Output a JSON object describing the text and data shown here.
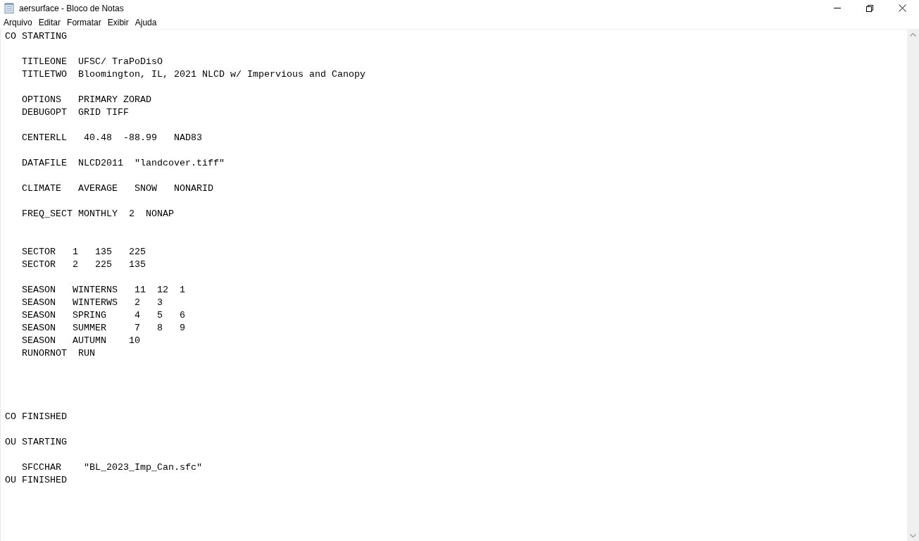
{
  "window": {
    "title": "aersurface - Bloco de Notas"
  },
  "menu": [
    "Arquivo",
    "Editar",
    "Formatar",
    "Exibir",
    "Ajuda"
  ],
  "lines": [
    {
      "kind": "text",
      "text": "CO STARTING"
    },
    {
      "kind": "blank"
    },
    {
      "kind": "text",
      "text": "   TITLEONE  UFSC/ TraPoDisO"
    },
    {
      "kind": "text",
      "text": "   TITLETWO  Bloomington, IL, 2021 NLCD w/ Impervious and Canopy"
    },
    {
      "kind": "blank"
    },
    {
      "kind": "text",
      "text": "   OPTIONS   PRIMARY ZORAD"
    },
    {
      "kind": "text",
      "text": "   DEBUGOPT  GRID TIFF"
    },
    {
      "kind": "blank"
    },
    {
      "kind": "text",
      "text": "   CENTERLL   40.48  -88.99   NAD83"
    },
    {
      "kind": "blank"
    },
    {
      "kind": "text",
      "text": "   DATAFILE  NLCD2011  \"landcover.tiff\""
    },
    {
      "kind": "blank"
    },
    {
      "kind": "text",
      "text": "   CLIMATE   AVERAGE   SNOW   NONARID"
    },
    {
      "kind": "blank"
    },
    {
      "kind": "text",
      "text": "   FREQ_SECT MONTHLY  2  NONAP"
    },
    {
      "kind": "blank"
    },
    {
      "kind": "blank"
    },
    {
      "kind": "text",
      "text": "   SECTOR   1   135   225"
    },
    {
      "kind": "text",
      "text": "   SECTOR   2   225   135"
    },
    {
      "kind": "blank"
    },
    {
      "kind": "text",
      "text": "   SEASON   WINTERNS   11  12  1"
    },
    {
      "kind": "text",
      "text": "   SEASON   WINTERWS   2   3"
    },
    {
      "kind": "text",
      "text": "   SEASON   SPRING     4   5   6"
    },
    {
      "kind": "text",
      "text": "   SEASON   SUMMER     7   8   9"
    },
    {
      "kind": "text",
      "text": "   SEASON   AUTUMN    10"
    },
    {
      "kind": "text",
      "text": "   RUNORNOT  RUN"
    },
    {
      "kind": "blank"
    },
    {
      "kind": "blank"
    },
    {
      "kind": "blank"
    },
    {
      "kind": "blank"
    },
    {
      "kind": "text",
      "text": "CO FINISHED"
    },
    {
      "kind": "blank"
    },
    {
      "kind": "text",
      "text": "OU STARTING"
    },
    {
      "kind": "blank"
    },
    {
      "kind": "text",
      "text": "   SFCCHAR    \"BL_2023_Imp_Can.sfc\""
    },
    {
      "kind": "text",
      "text": "OU FINISHED"
    }
  ]
}
